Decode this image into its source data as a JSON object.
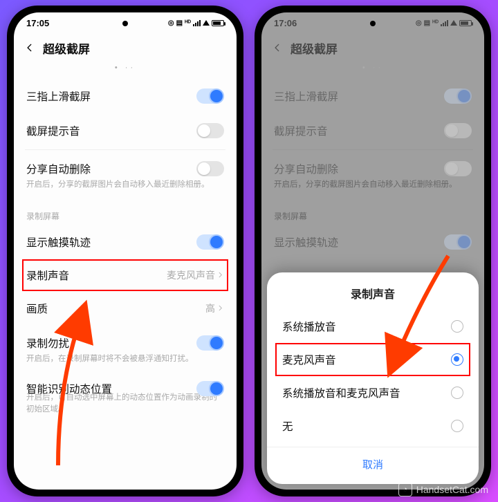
{
  "watermark": "HandsetCat.com",
  "phoneA": {
    "time": "17:05",
    "title": "超级截屏",
    "items": {
      "three_finger": "三指上滑截屏",
      "sound_tip": "截屏提示音",
      "auto_delete": "分享自动删除",
      "auto_delete_sub": "开启后，分享的截屏图片会自动移入最近删除相册。",
      "section_record": "录制屏幕",
      "show_touch": "显示触摸轨迹",
      "record_sound": "录制声音",
      "record_sound_value": "麦克风声音",
      "quality": "画质",
      "quality_value": "高",
      "dnd": "录制勿扰",
      "dnd_sub": "开启后，在录制屏幕时将不会被悬浮通知打扰。",
      "smart_pos": "智能识别动态位置",
      "smart_pos_sub": "开启后，可自动选中屏幕上的动态位置作为动画录制的初始区域。"
    }
  },
  "phoneB": {
    "time": "17:06",
    "title": "超级截屏",
    "dialog": {
      "title": "录制声音",
      "opt_system": "系统播放音",
      "opt_mic": "麦克风声音",
      "opt_both": "系统播放音和麦克风声音",
      "opt_none": "无",
      "cancel": "取消"
    }
  }
}
